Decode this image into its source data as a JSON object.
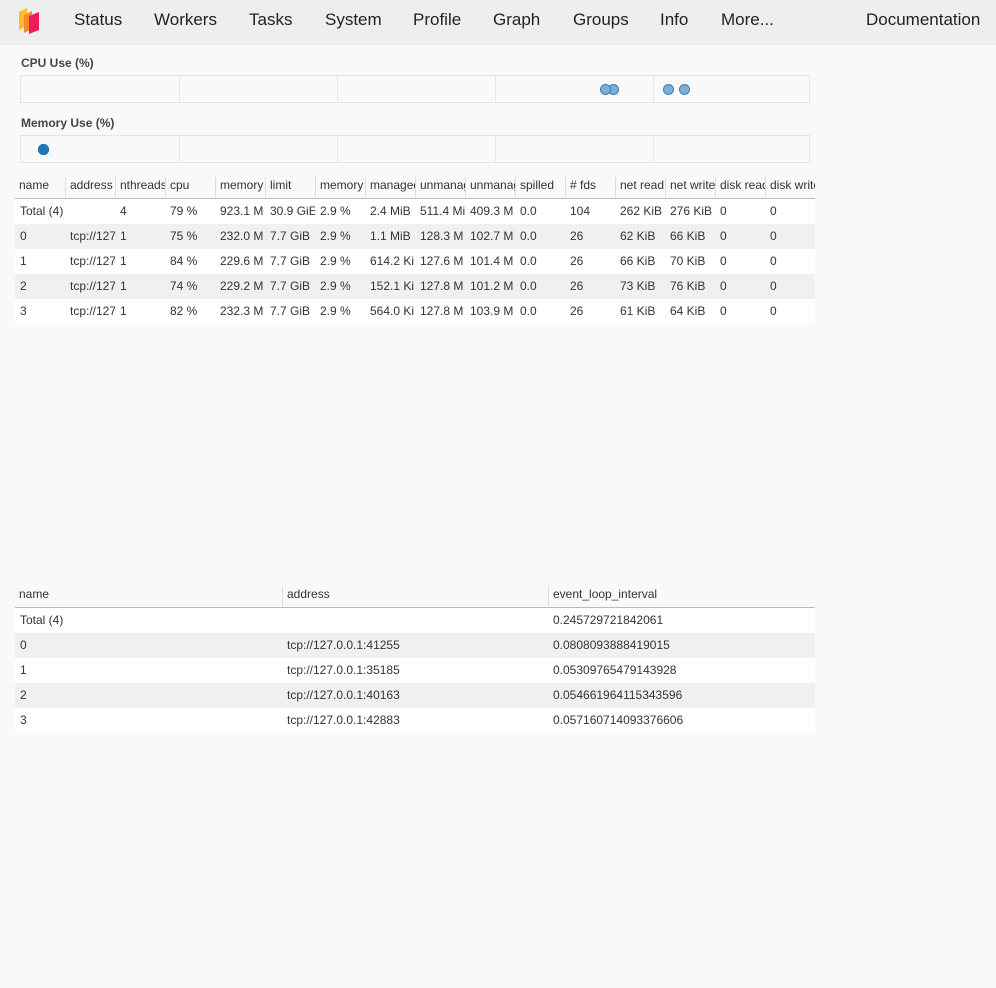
{
  "nav": {
    "items": [
      "Status",
      "Workers",
      "Tasks",
      "System",
      "Profile",
      "Graph",
      "Groups",
      "Info",
      "More..."
    ],
    "right": "Documentation",
    "logo_colors": [
      "#fdbb2d",
      "#ef1a5a"
    ]
  },
  "cpu_chart": {
    "title": "CPU Use (%)",
    "dot_color": "#7bafd8",
    "dot_border": "#3a7cb0"
  },
  "memory_chart": {
    "title": "Memory Use (%)",
    "dot_color": "#1f77b4"
  },
  "chart_data": [
    {
      "type": "scatter",
      "title": "CPU Use (%)",
      "series": [
        {
          "values": [
            75,
            84,
            74,
            82
          ]
        }
      ],
      "xlim": [
        0,
        100
      ]
    },
    {
      "type": "scatter",
      "title": "Memory Use (%)",
      "series": [
        {
          "values": [
            2.9,
            2.9,
            2.9,
            2.9
          ]
        }
      ],
      "xlim": [
        0,
        100
      ]
    }
  ],
  "workers_table": {
    "columns": [
      "name",
      "address",
      "nthreads",
      "cpu",
      "memory",
      "limit",
      "memory",
      "managed",
      "unmanaged",
      "unmanaged",
      "spilled",
      "# fds",
      "net read",
      "net write",
      "disk read",
      "disk write"
    ],
    "rows": [
      [
        "Total (4)",
        "",
        "4",
        "79 %",
        "923.1 M",
        "30.9 GiE",
        "2.9 %",
        "2.4 MiB",
        "511.4 Mi",
        "409.3 M",
        "0.0",
        "104",
        "262 KiB",
        "276 KiB",
        "0",
        "0"
      ],
      [
        "0",
        "tcp://127",
        "1",
        "75 %",
        "232.0 M",
        "7.7 GiB",
        "2.9 %",
        "1.1 MiB",
        "128.3 M",
        "102.7 M",
        "0.0",
        "26",
        "62 KiB",
        "66 KiB",
        "0",
        "0"
      ],
      [
        "1",
        "tcp://127",
        "1",
        "84 %",
        "229.6 M",
        "7.7 GiB",
        "2.9 %",
        "614.2 Ki",
        "127.6 M",
        "101.4 M",
        "0.0",
        "26",
        "66 KiB",
        "70 KiB",
        "0",
        "0"
      ],
      [
        "2",
        "tcp://127",
        "1",
        "74 %",
        "229.2 M",
        "7.7 GiB",
        "2.9 %",
        "152.1 Ki",
        "127.8 M",
        "101.2 M",
        "0.0",
        "26",
        "73 KiB",
        "76 KiB",
        "0",
        "0"
      ],
      [
        "3",
        "tcp://127",
        "1",
        "82 %",
        "232.3 M",
        "7.7 GiB",
        "2.9 %",
        "564.0 Ki",
        "127.8 M",
        "103.9 M",
        "0.0",
        "26",
        "61 KiB",
        "64 KiB",
        "0",
        "0"
      ]
    ]
  },
  "event_loop_table": {
    "columns": [
      "name",
      "address",
      "event_loop_interval"
    ],
    "rows": [
      [
        "Total (4)",
        "",
        "0.245729721842061"
      ],
      [
        "0",
        "tcp://127.0.0.1:41255",
        "0.0808093888419015"
      ],
      [
        "1",
        "tcp://127.0.0.1:35185",
        "0.05309765479143928"
      ],
      [
        "2",
        "tcp://127.0.0.1:40163",
        "0.054661964115343596"
      ],
      [
        "3",
        "tcp://127.0.0.1:42883",
        "0.057160714093376606"
      ]
    ]
  }
}
